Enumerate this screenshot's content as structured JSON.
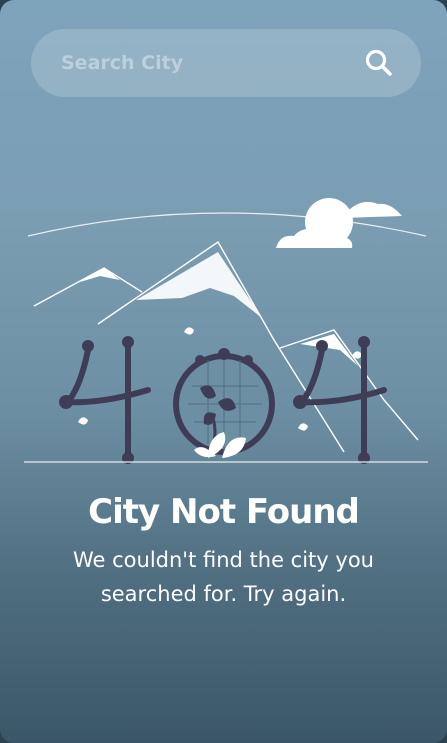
{
  "search": {
    "placeholder": "Search City",
    "value": "",
    "icon": "search-icon"
  },
  "error": {
    "illustration_icon": "404-mountains-illustration",
    "title": "City Not Found",
    "message": "We couldn't find the city you searched for. Try again."
  },
  "colors": {
    "gradient_top": "#7ea4bb",
    "gradient_bottom": "#3b5767",
    "text": "#ffffff",
    "illustration_dark": "#3f3d56"
  }
}
